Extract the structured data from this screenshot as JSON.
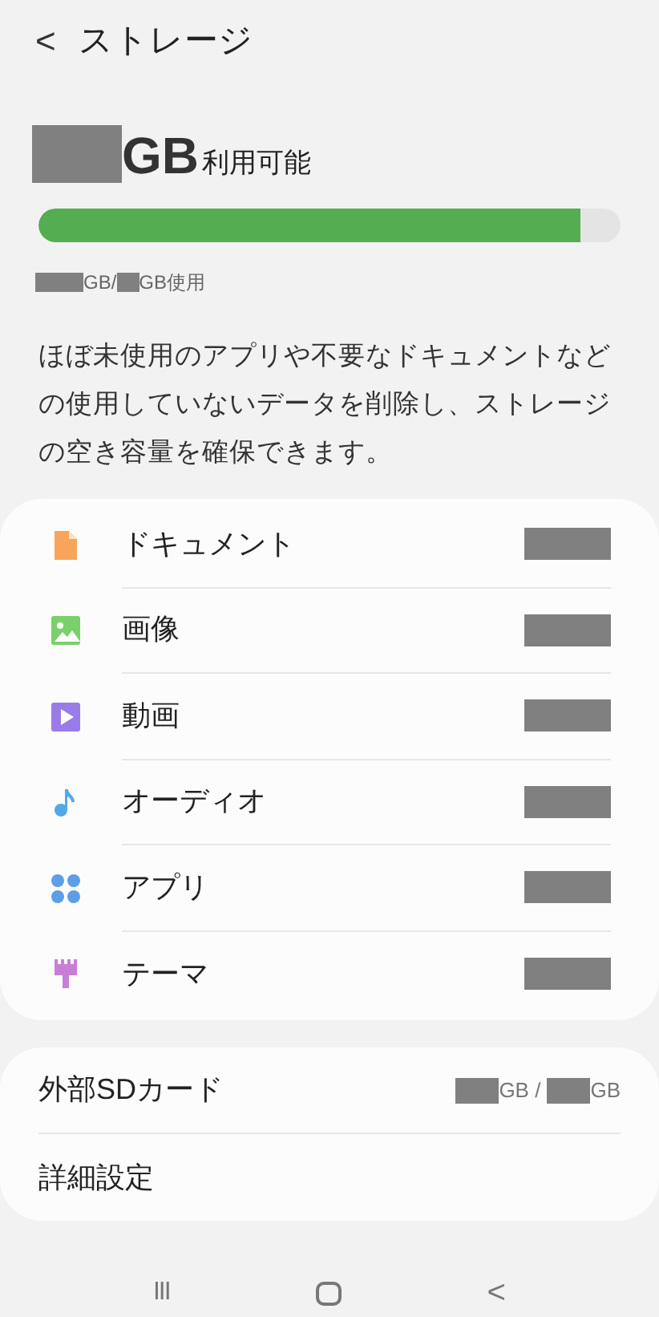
{
  "header": {
    "back": "<",
    "title": "ストレージ"
  },
  "summary": {
    "unit": "GB",
    "available_label": "利用可能",
    "usage": {
      "level": 0.93,
      "used_unit": "GB/",
      "total_unit": "GB使用"
    }
  },
  "description": "ほぼ未使用のアプリや不要なドキュメントなどの使用していないデータを削除し、ストレージの空き容量を確保できます。",
  "categories": [
    {
      "kind": "document",
      "label": "ドキュメント",
      "color": "#f7a55a"
    },
    {
      "kind": "image",
      "label": "画像",
      "color": "#7ad06a"
    },
    {
      "kind": "video",
      "label": "動画",
      "color": "#9a7ce8"
    },
    {
      "kind": "audio",
      "label": "オーディオ",
      "color": "#52a9e4"
    },
    {
      "kind": "apps",
      "label": "アプリ",
      "color": "#5c9ee8"
    },
    {
      "kind": "theme",
      "label": "テーマ",
      "color": "#c77fd6"
    }
  ],
  "settings": [
    {
      "kind": "sd",
      "label": "外部SDカード",
      "used_unit": "GB /",
      "total_unit": "GB"
    },
    {
      "kind": "plain",
      "label": "詳細設定"
    }
  ],
  "nav": {
    "recent": "III",
    "back": "<"
  }
}
